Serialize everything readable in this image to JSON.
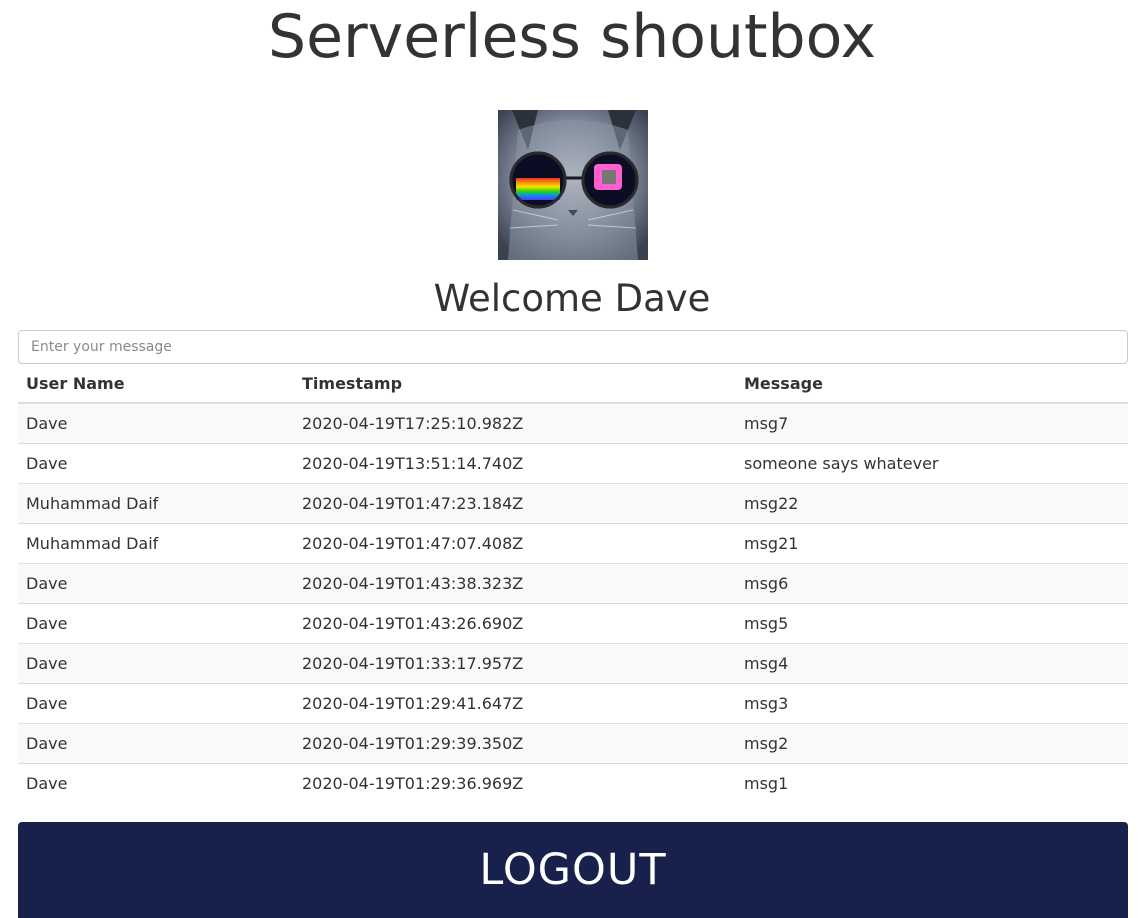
{
  "header": {
    "title": "Serverless shoutbox"
  },
  "profile": {
    "avatar_icon": "cat-with-sunglasses-avatar",
    "welcome": "Welcome Dave"
  },
  "composer": {
    "placeholder": "Enter your message",
    "value": ""
  },
  "table": {
    "headers": [
      "User Name",
      "Timestamp",
      "Message"
    ],
    "rows": [
      [
        "Dave",
        "2020-04-19T17:25:10.982Z",
        "msg7"
      ],
      [
        "Dave",
        "2020-04-19T13:51:14.740Z",
        "someone says whatever"
      ],
      [
        "Muhammad Daif",
        "2020-04-19T01:47:23.184Z",
        "msg22"
      ],
      [
        "Muhammad Daif",
        "2020-04-19T01:47:07.408Z",
        "msg21"
      ],
      [
        "Dave",
        "2020-04-19T01:43:38.323Z",
        "msg6"
      ],
      [
        "Dave",
        "2020-04-19T01:43:26.690Z",
        "msg5"
      ],
      [
        "Dave",
        "2020-04-19T01:33:17.957Z",
        "msg4"
      ],
      [
        "Dave",
        "2020-04-19T01:29:41.647Z",
        "msg3"
      ],
      [
        "Dave",
        "2020-04-19T01:29:39.350Z",
        "msg2"
      ],
      [
        "Dave",
        "2020-04-19T01:29:36.969Z",
        "msg1"
      ]
    ]
  },
  "actions": {
    "logout_label": "LOGOUT"
  },
  "colors": {
    "logout_bg": "#18204c",
    "text": "#333333",
    "row_stripe": "#f9f9f9"
  }
}
